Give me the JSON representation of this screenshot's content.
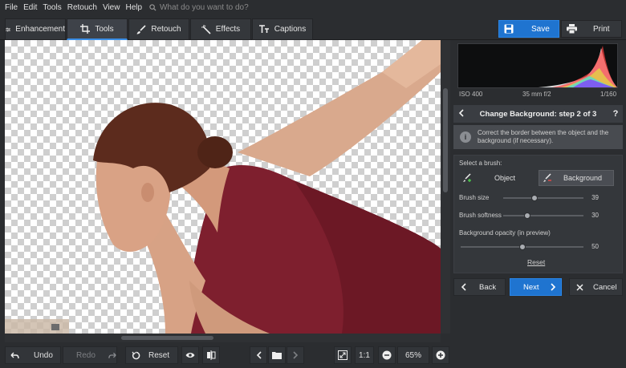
{
  "menu": [
    "File",
    "Edit",
    "Tools",
    "Retouch",
    "View",
    "Help"
  ],
  "search": {
    "placeholder": "What do you want to do?"
  },
  "tabs": [
    {
      "label": "Enhancement",
      "icon": "sliders-icon"
    },
    {
      "label": "Tools",
      "icon": "crop-icon",
      "active": true
    },
    {
      "label": "Retouch",
      "icon": "brush-icon"
    },
    {
      "label": "Effects",
      "icon": "magic-wand-icon"
    },
    {
      "label": "Captions",
      "icon": "text-icon"
    }
  ],
  "actions": {
    "save": "Save",
    "print": "Print"
  },
  "exif": {
    "iso": "ISO 400",
    "lens": "35 mm f/2",
    "shutter": "1/160"
  },
  "wizard": {
    "title": "Change Background: step 2 of 3",
    "help": "?",
    "info": "Correct the border between the object and the background (if necessary).",
    "select_brush": "Select a brush:",
    "brush_object": "Object",
    "brush_background": "Background",
    "selected_brush": "Background",
    "brush_size_label": "Brush size",
    "brush_size_value": "39",
    "brush_softness_label": "Brush softness",
    "brush_softness_value": "30",
    "bg_opacity_label": "Background opacity (in preview)",
    "bg_opacity_value": "50",
    "reset": "Reset",
    "back": "Back",
    "next": "Next",
    "cancel": "Cancel"
  },
  "bottom": {
    "undo": "Undo",
    "redo": "Redo",
    "reset": "Reset",
    "one_to_one": "1:1",
    "zoom": "65%"
  },
  "colors": {
    "accent": "#1f74d0",
    "garment": "#7e1f2e"
  }
}
